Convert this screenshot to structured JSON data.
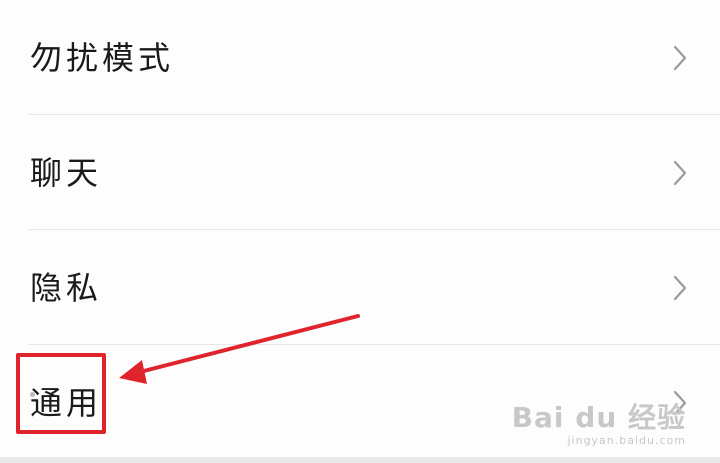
{
  "settings_list": {
    "items": [
      {
        "label": "勿扰模式",
        "chevron_icon": "chevron-right-icon"
      },
      {
        "label": "聊天",
        "chevron_icon": "chevron-right-icon"
      },
      {
        "label": "隐私",
        "chevron_icon": "chevron-right-icon"
      },
      {
        "label": "通用",
        "chevron_icon": "chevron-right-icon"
      }
    ]
  },
  "annotation": {
    "highlight_color": "#e0242b",
    "highlighted_item": "通用",
    "arrow_icon": "arrow-left-icon"
  },
  "watermark": {
    "logo": "Bai du 经验",
    "url": "jingyan.baidu.com"
  },
  "colors": {
    "text": "#1a1a1a",
    "divider": "#e6e6e6",
    "chevron": "#9a9a9a",
    "background": "#fdfdfd"
  }
}
